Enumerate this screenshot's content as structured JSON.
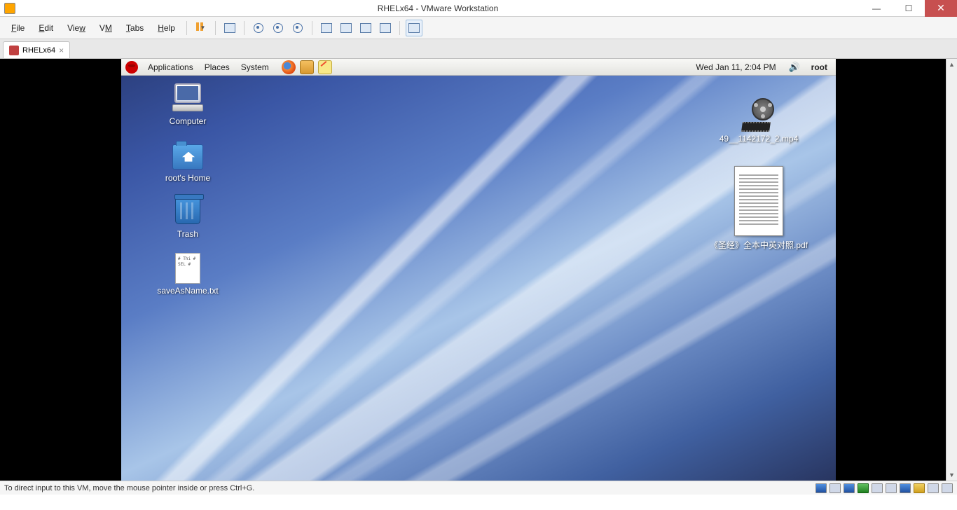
{
  "window": {
    "title": "RHELx64 - VMware Workstation"
  },
  "menubar": {
    "file": "File",
    "edit": "Edit",
    "view": "View",
    "vm": "VM",
    "tabs": "Tabs",
    "help": "Help"
  },
  "tab": {
    "label": "RHELx64"
  },
  "gnome": {
    "applications": "Applications",
    "places": "Places",
    "system": "System",
    "datetime": "Wed Jan 11,  2:04 PM",
    "user": "root"
  },
  "desktop": {
    "computer": "Computer",
    "home": "root's Home",
    "trash": "Trash",
    "txtfile": "saveAsName.txt",
    "txtcontent": "# Thi\n# SEL\n#",
    "video": "49__1142172_2.mp4",
    "pdf": "《圣经》全本中英对照.pdf"
  },
  "statusbar": {
    "hint": "To direct input to this VM, move the mouse pointer inside or press Ctrl+G."
  }
}
